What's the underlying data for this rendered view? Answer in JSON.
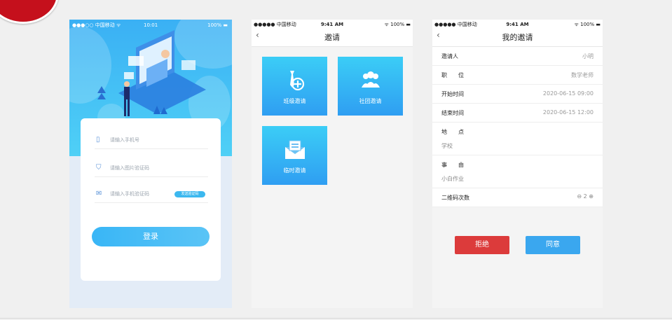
{
  "login_screen": {
    "status_bar": {
      "carrier": "●●●○○ 中国移动 ᯤ",
      "time": "10:01",
      "battery": "100% ▬"
    },
    "phone_placeholder": "请输入手机号",
    "image_code_placeholder": "请输入图片验证码",
    "sms_code_placeholder": "请输入手机验证码",
    "get_code_label": "发送验证码",
    "login_label": "登录",
    "icons": [
      "phone-icon",
      "shield-icon",
      "mail-icon"
    ]
  },
  "invite_screen": {
    "status_bar": {
      "carrier": "●●●●● 中国移动",
      "time": "9:41 AM",
      "battery": "ᯤ 100% ▬"
    },
    "title": "邀请",
    "back_glyph": "‹",
    "tiles": [
      {
        "label": "班级邀请",
        "icon": "tie-plus-icon"
      },
      {
        "label": "社团邀请",
        "icon": "group-icon"
      },
      {
        "label": "临时邀请",
        "icon": "envelope-icon"
      }
    ]
  },
  "my_invite_screen": {
    "status_bar": {
      "carrier": "●●●●● 中国移动",
      "time": "9:41 AM",
      "battery": "ᯤ 100% ▬"
    },
    "title": "我的邀请",
    "back_glyph": "‹",
    "rows": [
      {
        "key": "邀请人",
        "value": "小明"
      },
      {
        "key": "职　　位",
        "value": "数学老师"
      },
      {
        "key": "开始时间",
        "value": "2020-06-15 09:00"
      },
      {
        "key": "结束时间",
        "value": "2020-06-15 12:00"
      },
      {
        "key": "地　　点",
        "sub": "学校"
      },
      {
        "key": "事　　由",
        "sub": "小白作业"
      },
      {
        "key": "二维码次数",
        "minus": "⊖",
        "count": "2",
        "plus": "⊕"
      }
    ],
    "reject_label": "拒绝",
    "agree_label": "同意"
  },
  "colors": {
    "accent": "#3aa7ef",
    "reject": "#dc3b3b",
    "corner": "#c5101c"
  }
}
